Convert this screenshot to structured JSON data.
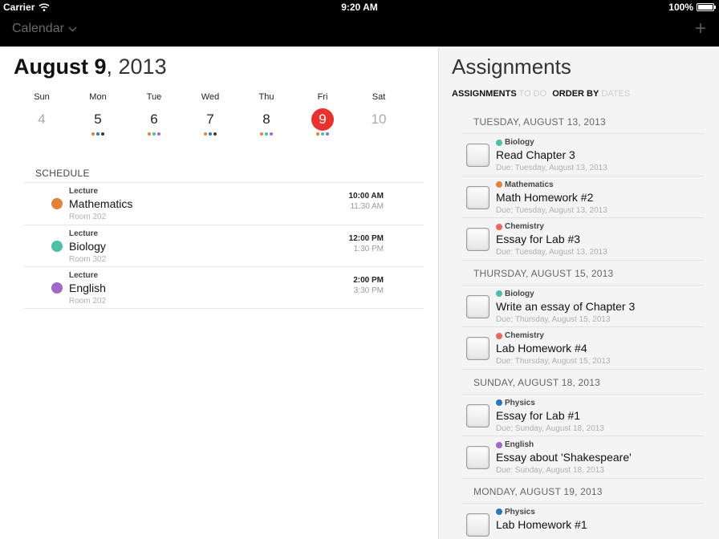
{
  "status": {
    "carrier": "Carrier",
    "time": "9:20 AM",
    "battery": "100%"
  },
  "nav": {
    "title": "Calendar",
    "add": "+"
  },
  "date": {
    "month_day": "August 9",
    "year": ", 2013"
  },
  "week": [
    {
      "name": "Sun",
      "num": "4",
      "muted": true,
      "dots": []
    },
    {
      "name": "Mon",
      "num": "5",
      "dots": [
        "#e0823c",
        "#2c77b6",
        "#3a3a3a"
      ]
    },
    {
      "name": "Tue",
      "num": "6",
      "dots": [
        "#e0823c",
        "#4cbfa6",
        "#a168c8"
      ]
    },
    {
      "name": "Wed",
      "num": "7",
      "dots": [
        "#e0823c",
        "#2c77b6",
        "#3a3a3a"
      ]
    },
    {
      "name": "Thu",
      "num": "8",
      "dots": [
        "#e0823c",
        "#4cbfa6",
        "#a168c8"
      ]
    },
    {
      "name": "Fri",
      "num": "9",
      "selected": true,
      "dots": [
        "#e0823c",
        "#4cbfa6",
        "#a168c8"
      ]
    },
    {
      "name": "Sat",
      "num": "10",
      "muted": true,
      "dots": []
    }
  ],
  "schedule": {
    "label": "SCHEDULE",
    "events": [
      {
        "kind": "Lecture",
        "name": "Mathematics",
        "room": "Room 202",
        "start": "10:00 AM",
        "end": "11:30 AM",
        "color": "#e0823c"
      },
      {
        "kind": "Lecture",
        "name": "Biology",
        "room": "Room 302",
        "start": "12:00 PM",
        "end": "1:30 PM",
        "color": "#4cbfa6"
      },
      {
        "kind": "Lecture",
        "name": "English",
        "room": "Room 202",
        "start": "2:00 PM",
        "end": "3:30 PM",
        "color": "#a168c8"
      }
    ]
  },
  "assignments": {
    "heading": "Assignments",
    "filter": {
      "k1": "ASSIGNMENTS",
      "v1": "TO DO",
      "k2": "ORDER BY",
      "v2": "DATES"
    },
    "sections": [
      {
        "header": "TUESDAY, AUGUST 13, 2013",
        "items": [
          {
            "subject": "Biology",
            "color": "#4cbfa6",
            "title": "Read Chapter 3",
            "due": "Due: Tuesday, August 13, 2013"
          },
          {
            "subject": "Mathematics",
            "color": "#e0823c",
            "title": "Math Homework #2",
            "due": "Due: Tuesday, August 13, 2013"
          },
          {
            "subject": "Chemistry",
            "color": "#e8685c",
            "title": "Essay for Lab #3",
            "due": "Due: Tuesday, August 13, 2013"
          }
        ]
      },
      {
        "header": "THURSDAY, AUGUST 15, 2013",
        "items": [
          {
            "subject": "Biology",
            "color": "#4cbfa6",
            "title": "Write an essay of Chapter 3",
            "due": "Due: Thursday, August 15, 2013"
          },
          {
            "subject": "Chemistry",
            "color": "#e8685c",
            "title": "Lab Homework #4",
            "due": "Due: Thursday, August 15, 2013"
          }
        ]
      },
      {
        "header": "SUNDAY, AUGUST 18, 2013",
        "items": [
          {
            "subject": "Physics",
            "color": "#2c77b6",
            "title": "Essay for Lab #1",
            "due": "Due: Sunday, August 18, 2013"
          },
          {
            "subject": "English",
            "color": "#a168c8",
            "title": "Essay about 'Shakespeare'",
            "due": "Due: Sunday, August 18, 2013"
          }
        ]
      },
      {
        "header": "MONDAY, AUGUST 19, 2013",
        "items": [
          {
            "subject": "Physics",
            "color": "#2c77b6",
            "title": "Lab Homework #1",
            "due": ""
          }
        ]
      }
    ]
  }
}
